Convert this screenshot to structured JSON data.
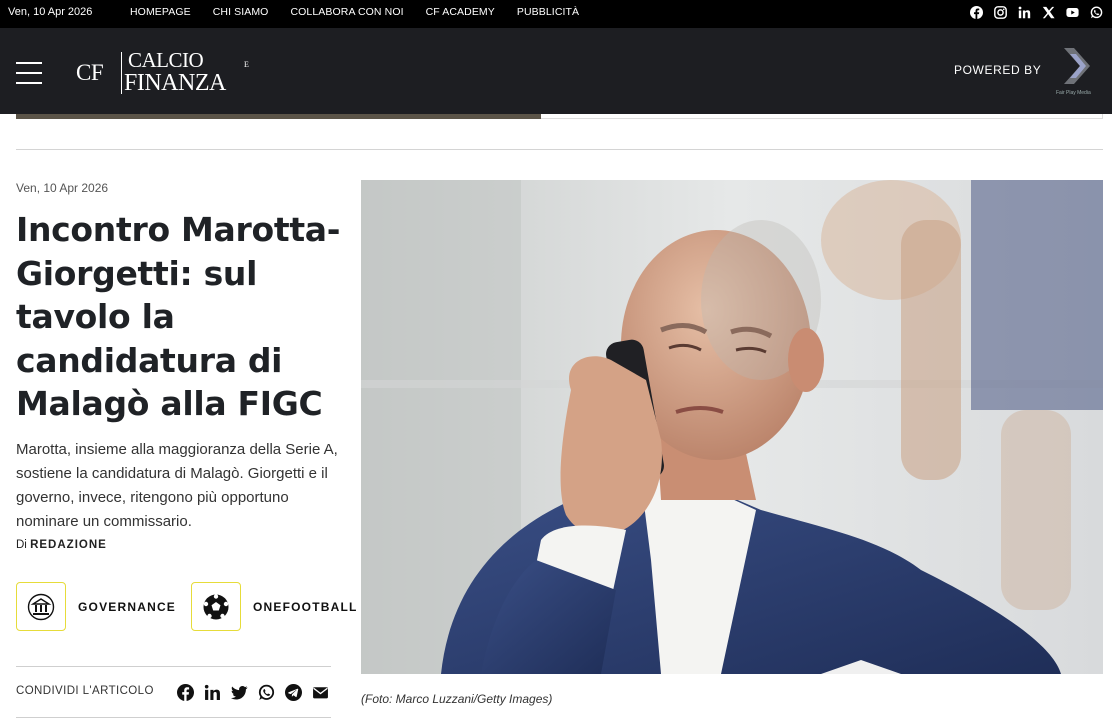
{
  "topbar": {
    "date": "Ven, 10 Apr 2026",
    "nav": [
      "HOMEPAGE",
      "CHI SIAMO",
      "COLLABORA CON NOI",
      "CF ACADEMY",
      "PUBBLICITÀ"
    ],
    "social_icons": [
      "facebook-icon",
      "instagram-icon",
      "linkedin-icon",
      "x-icon",
      "youtube-icon",
      "whatsapp-icon"
    ]
  },
  "header": {
    "logo_cf": "CF",
    "logo_calcio": "CALCIO",
    "logo_e": "E",
    "logo_finanza": "FINANZA",
    "powered_by": "POWERED BY",
    "partner_caption": "Fair Play Media"
  },
  "article": {
    "date": "Ven, 10 Apr 2026",
    "title": "Incontro Marotta-Giorgetti: sul tavolo la candidatura di Malagò alla FIGC",
    "lead": "Marotta, insieme alla maggioranza della Serie A, sostiene la candidatura di Malagò. Giorgetti e il governo, invece, ritengono più opportuno nominare un commissario.",
    "byline_prefix": "Di",
    "author": "REDAZIONE",
    "tags": [
      {
        "label": "GOVERNANCE",
        "icon": "governance-building-icon"
      },
      {
        "label": "ONEFOOTBALL",
        "icon": "football-icon"
      }
    ],
    "share_label": "CONDIVIDI L'ARTICOLO",
    "share_icons": [
      "facebook-icon",
      "linkedin-icon",
      "twitter-icon",
      "whatsapp-icon",
      "telegram-icon",
      "email-icon"
    ],
    "photo_caption": "(Foto: Marco Luzzani/Getty Images)"
  },
  "colors": {
    "topbar_bg": "#000000",
    "header_bg": "#1d1e22",
    "tag_border": "#e6dc3a",
    "jacket": "#2c3f72"
  }
}
